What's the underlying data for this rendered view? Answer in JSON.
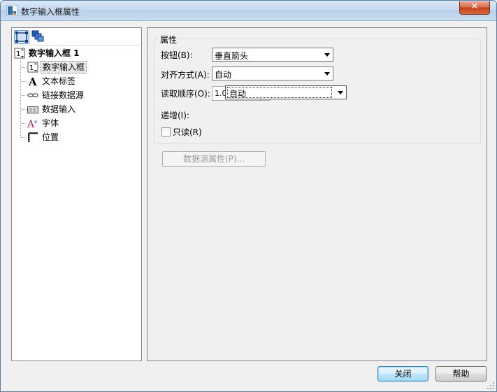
{
  "window": {
    "title": "数字输入框属性",
    "close_glyph": "✕"
  },
  "tree": {
    "toolbar": {
      "btn1_icon": "tree-view-icon",
      "btn2_icon": "layers-icon"
    },
    "root": {
      "label": "数字输入框 1",
      "icon": "numeric-spinner-icon"
    },
    "items": [
      {
        "label": "数字输入框",
        "icon": "numeric-spinner-icon"
      },
      {
        "label": "文本标签",
        "icon": "text-label-icon"
      },
      {
        "label": "链接数据源",
        "icon": "link-icon"
      },
      {
        "label": "数据输入",
        "icon": "keyboard-icon"
      },
      {
        "label": "字体",
        "icon": "font-icon"
      },
      {
        "label": "位置",
        "icon": "position-icon"
      }
    ]
  },
  "properties": {
    "group_title": "属性",
    "button_label": "按钮(B):",
    "button_value": "垂直箭头",
    "align_label": "对齐方式(A):",
    "align_value": "自动",
    "read_order_label": "读取顺序(O):",
    "increment_value": "1.0",
    "read_order_value": "自动",
    "increment_label": "递增(I):",
    "readonly_label": "只读(R)",
    "readonly_checked": false,
    "datasource_button": "数据源属性(P)..."
  },
  "footer": {
    "close_button": "关闭",
    "help_button": "帮助"
  }
}
